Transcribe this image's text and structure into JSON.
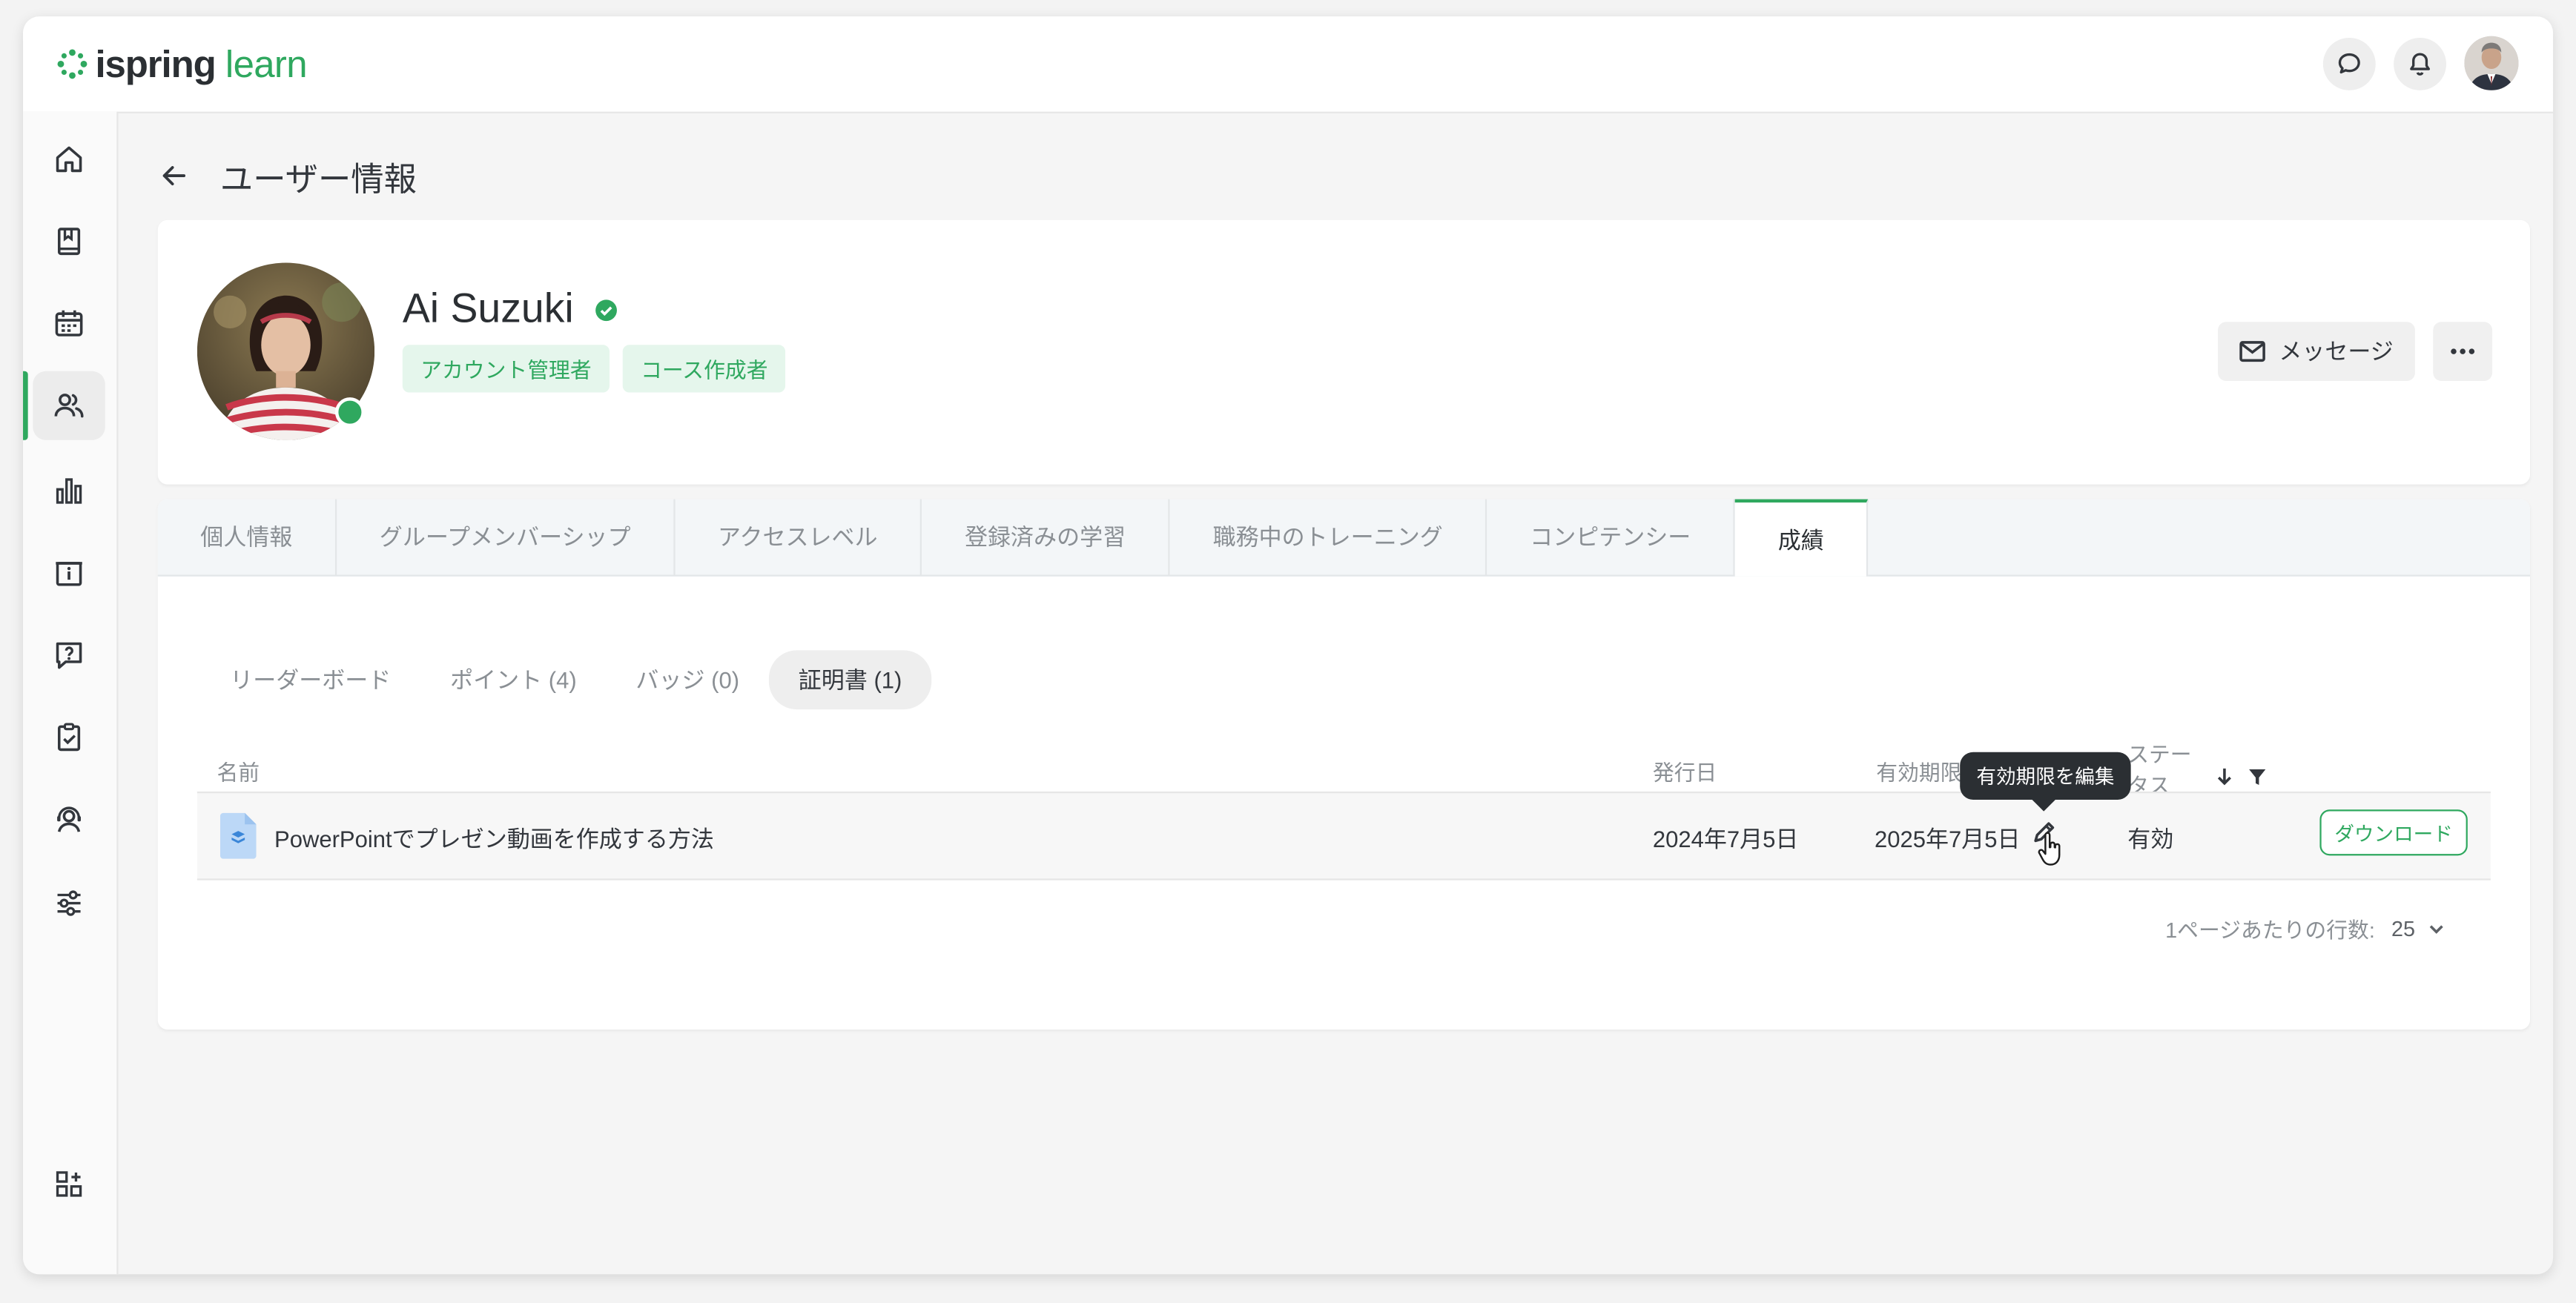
{
  "header": {
    "logo_primary": "ispring",
    "logo_secondary": "learn",
    "brand_color": "#2fa85f",
    "icons": [
      "chat-icon",
      "bell-icon",
      "user-avatar"
    ]
  },
  "sidebar": {
    "items": [
      {
        "icon": "home-icon"
      },
      {
        "icon": "book-icon"
      },
      {
        "icon": "calendar-icon"
      },
      {
        "icon": "users-icon",
        "active": true
      },
      {
        "icon": "chart-icon"
      },
      {
        "icon": "info-board-icon"
      },
      {
        "icon": "question-chat-icon"
      },
      {
        "icon": "clipboard-check-icon"
      },
      {
        "icon": "user-support-icon"
      },
      {
        "icon": "sliders-icon"
      }
    ],
    "bottom_icon": "apps-icon"
  },
  "page": {
    "title": "ユーザー情報"
  },
  "profile": {
    "name": "Ai Suzuki",
    "roles": [
      "アカウント管理者",
      "コース作成者"
    ],
    "message_label": "メッセージ"
  },
  "tabs": [
    "個人情報",
    "グループメンバーシップ",
    "アクセスレベル",
    "登録済みの学習",
    "職務中のトレーニング",
    "コンピテンシー",
    "成績"
  ],
  "active_tab": "成績",
  "subtabs": [
    "リーダーボード",
    "ポイント (4)",
    "バッジ (0)",
    "証明書 (1)"
  ],
  "active_subtab": "証明書 (1)",
  "table": {
    "headers": {
      "name": "名前",
      "issued": "発行日",
      "expires": "有効期限",
      "status_line1": "ステー",
      "status_line2": "タス"
    },
    "rows": [
      {
        "name": "PowerPointでプレゼン動画を作成する方法",
        "issued": "2024年7月5日",
        "expires": "2025年7月5日",
        "status": "有効",
        "action": "ダウンロード"
      }
    ],
    "tooltip": "有効期限を編集"
  },
  "pagination": {
    "label": "1ページあたりの行数:",
    "value": "25"
  }
}
